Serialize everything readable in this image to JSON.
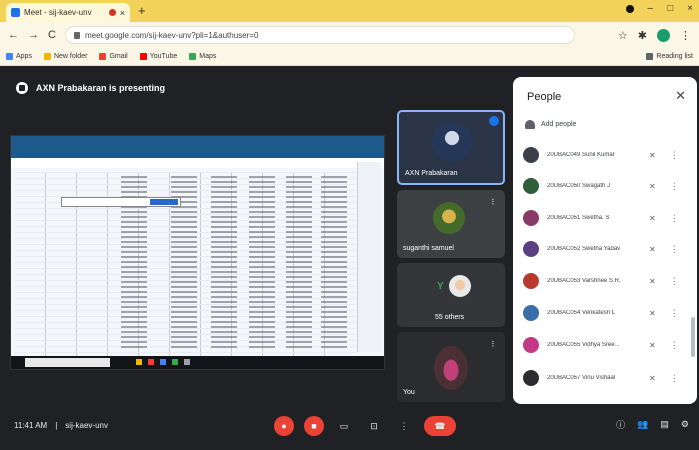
{
  "browser": {
    "tab_title": "Meet - sij-kaev-unv",
    "url": "meet.google.com/sij-kaev-unv?pli=1&authuser=0",
    "bookmarks": [
      {
        "label": "Apps",
        "color": "#4285f4"
      },
      {
        "label": "New folder",
        "color": "#f2b600"
      },
      {
        "label": "Gmail",
        "color": "#ea4335"
      },
      {
        "label": "YouTube",
        "color": "#ff0000"
      },
      {
        "label": "Maps",
        "color": "#34a853"
      }
    ],
    "reading_list": "Reading list"
  },
  "meeting": {
    "presenting_text": "AXN Prabakaran is presenting",
    "time": "11:41 AM",
    "code": "sij-kaev-unv"
  },
  "tiles": [
    {
      "name": "AXN Prabakaran"
    },
    {
      "name": "suganthi samuel"
    },
    {
      "name": "55 others",
      "letter": "Y"
    },
    {
      "name": "You"
    }
  ],
  "people": {
    "title": "People",
    "add_people": "Add people",
    "participants": [
      {
        "name": "20UBAC049 Sunil Kumar",
        "color": "#3a3f4a"
      },
      {
        "name": "20UBAC050 Swagath J",
        "color": "#2d5f3a"
      },
      {
        "name": "20UBAC051 Swetha. S",
        "color": "#8a3a66"
      },
      {
        "name": "20UBAC052 Swetha Yadav",
        "color": "#5a3f82"
      },
      {
        "name": "20UBAC053 Varshnee S.R.",
        "color": "#b83a2e"
      },
      {
        "name": "20UBAC054 Venkatesh L",
        "color": "#3a6ea8"
      },
      {
        "name": "20UBAC055 Vidhya Sree...",
        "color": "#c23a86"
      },
      {
        "name": "20UBAC057 Vinu Vishaal",
        "color": "#2d2d30"
      }
    ]
  },
  "shared_screen": {
    "popup_button": "New metric"
  }
}
